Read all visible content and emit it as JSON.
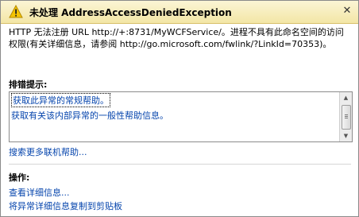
{
  "dialog": {
    "title": "未处理 AddressAccessDeniedException",
    "icon": "warning-icon",
    "close_glyph": "✕",
    "message": "HTTP 无法注册 URL http://+:8731/MyWCFService/。进程不具有此命名空间的访问权限(有关详细信息，请参阅 http://go.microsoft.com/fwlink/?LinkId=70353)。"
  },
  "troubleshooting": {
    "heading": "排错提示:",
    "tips": [
      "获取此异常的常规帮助。",
      "获取有关该内部异常的一般性帮助信息。"
    ],
    "more_link": "搜索更多联机帮助..."
  },
  "actions": {
    "heading": "操作:",
    "items": [
      "查看详细信息...",
      "将异常详细信息复制到剪贴板"
    ]
  },
  "colors": {
    "link": "#0645ad",
    "titlebar": "#f3e6a6",
    "warning": "#f5c400"
  }
}
